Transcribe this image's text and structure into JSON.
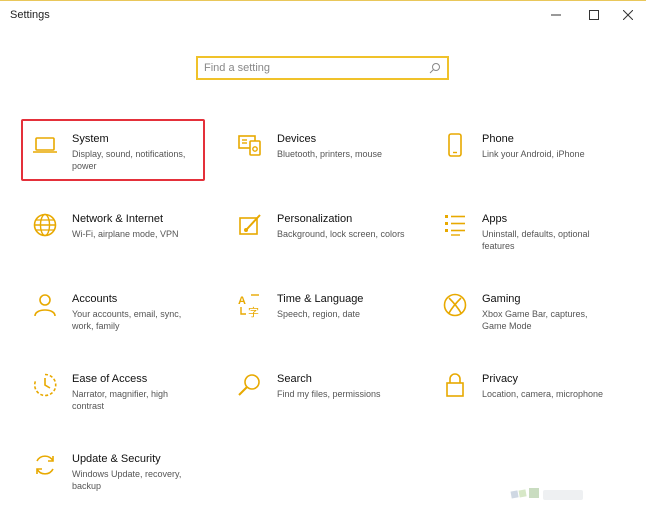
{
  "window": {
    "title": "Settings"
  },
  "search": {
    "placeholder": "Find a setting"
  },
  "tiles": [
    {
      "name": "System",
      "desc": "Display, sound, notifications, power",
      "icon": "laptop-icon"
    },
    {
      "name": "Devices",
      "desc": "Bluetooth, printers, mouse",
      "icon": "devices-icon"
    },
    {
      "name": "Phone",
      "desc": "Link your Android, iPhone",
      "icon": "phone-icon"
    },
    {
      "name": "Network & Internet",
      "desc": "Wi-Fi, airplane mode, VPN",
      "icon": "globe-icon"
    },
    {
      "name": "Personalization",
      "desc": "Background, lock screen, colors",
      "icon": "paint-icon"
    },
    {
      "name": "Apps",
      "desc": "Uninstall, defaults, optional features",
      "icon": "apps-list-icon"
    },
    {
      "name": "Accounts",
      "desc": "Your accounts, email, sync, work, family",
      "icon": "person-icon"
    },
    {
      "name": "Time & Language",
      "desc": "Speech, region, date",
      "icon": "time-language-icon"
    },
    {
      "name": "Gaming",
      "desc": "Xbox Game Bar, captures, Game Mode",
      "icon": "xbox-icon"
    },
    {
      "name": "Ease of Access",
      "desc": "Narrator, magnifier, high contrast",
      "icon": "ease-of-access-icon"
    },
    {
      "name": "Search",
      "desc": "Find my files, permissions",
      "icon": "search-icon"
    },
    {
      "name": "Privacy",
      "desc": "Location, camera, microphone",
      "icon": "lock-icon"
    },
    {
      "name": "Update & Security",
      "desc": "Windows Update, recovery, backup",
      "icon": "update-icon"
    }
  ],
  "colors": {
    "accent": "#f0c22a",
    "highlight": "#e4303a"
  }
}
